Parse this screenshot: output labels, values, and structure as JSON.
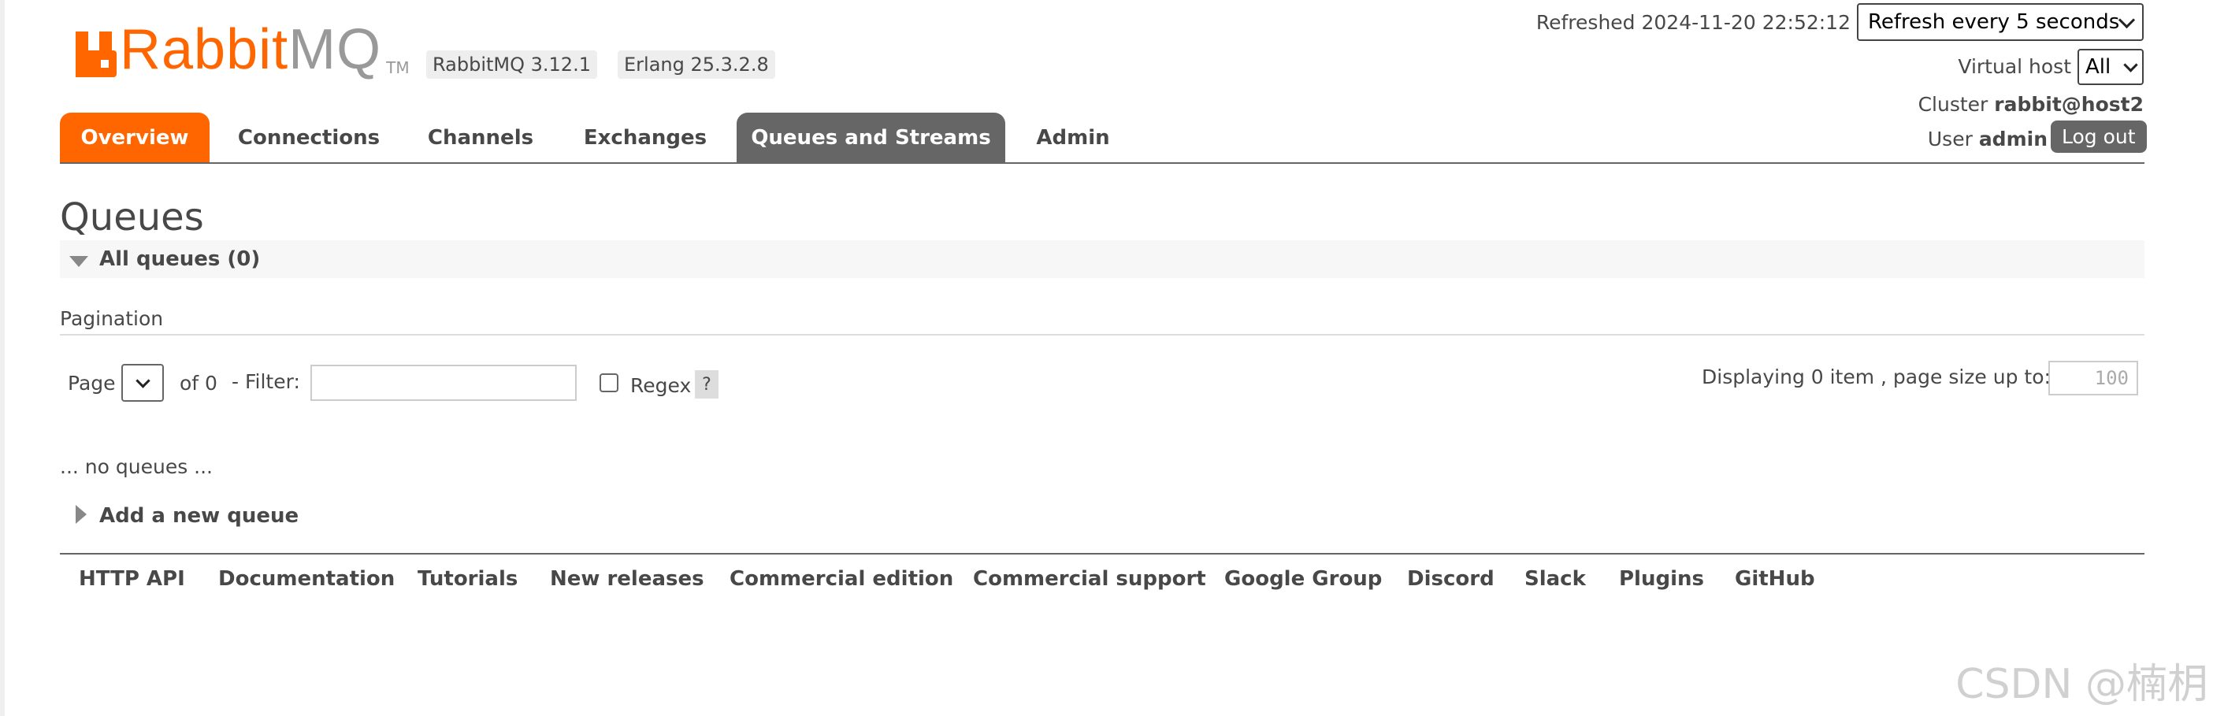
{
  "header": {
    "logo_rabbit": "Rabbit",
    "logo_mq": "MQ",
    "logo_tm": "TM",
    "version_badge": "RabbitMQ 3.12.1",
    "erlang_badge": "Erlang 25.3.2.8",
    "refreshed_label": "Refreshed 2024-11-20 22:52:12",
    "refresh_select": "Refresh every 5 seconds",
    "vhost_label": "Virtual host",
    "vhost_select": "All",
    "cluster_label": "Cluster",
    "cluster_value": "rabbit@host2",
    "user_label": "User",
    "user_value": "admin",
    "logout_label": "Log out"
  },
  "tabs": [
    {
      "label": "Overview"
    },
    {
      "label": "Connections"
    },
    {
      "label": "Channels"
    },
    {
      "label": "Exchanges"
    },
    {
      "label": "Queues and Streams"
    },
    {
      "label": "Admin"
    }
  ],
  "main": {
    "title": "Queues",
    "section_title": "All queues (0)",
    "pagination_label": "Pagination",
    "page_label": "Page",
    "of_label": "of 0",
    "filter_label": "- Filter:",
    "filter_value": "",
    "regex_label": "Regex",
    "help_label": "?",
    "displaying_label": "Displaying 0 item , page size up to:",
    "page_size_value": "100",
    "empty_text": "... no queues ...",
    "add_queue_label": "Add a new queue"
  },
  "footer": {
    "links": [
      "HTTP API",
      "Documentation",
      "Tutorials",
      "New releases",
      "Commercial edition",
      "Commercial support",
      "Google Group",
      "Discord",
      "Slack",
      "Plugins",
      "GitHub"
    ]
  },
  "watermark": "CSDN @楠枂",
  "colors": {
    "brand_orange": "#ff6600",
    "active_tab_grey": "#666666",
    "text": "#484848"
  }
}
